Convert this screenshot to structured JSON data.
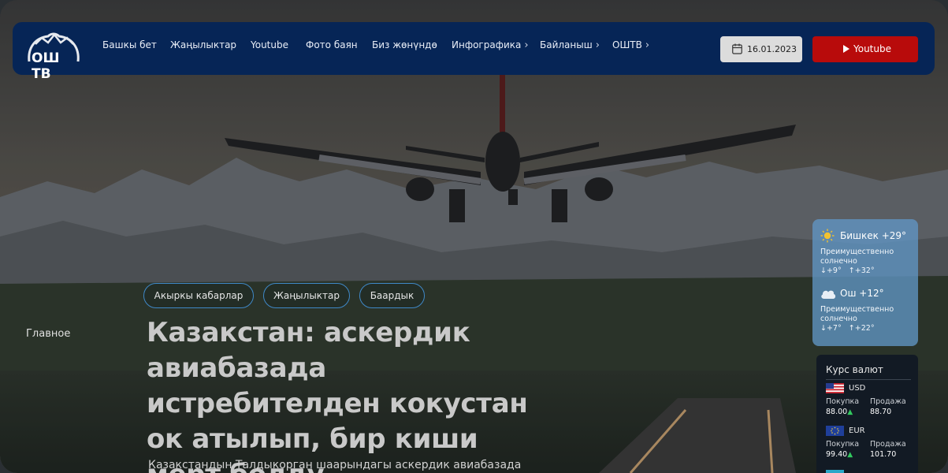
{
  "nav": {
    "logo_text": "ОШ ТВ",
    "items": [
      {
        "label": "Башкы бет",
        "dropdown": false
      },
      {
        "label": "Жаңылыктар",
        "dropdown": false
      },
      {
        "label": "Youtube",
        "dropdown": false
      },
      {
        "label": "Фото баян",
        "dropdown": false
      },
      {
        "label": "Биз жөнүндө",
        "dropdown": false
      },
      {
        "label": "Инфографика",
        "dropdown": true
      },
      {
        "label": "Байланыш",
        "dropdown": true
      },
      {
        "label": "ОШТВ",
        "dropdown": true
      }
    ],
    "date": "16.01.2023",
    "youtube_button": "Youtube"
  },
  "hero": {
    "tags": [
      "Акыркы кабарлар",
      "Жаңылыктар",
      "Баардык"
    ],
    "side_label": "Главное",
    "headline": "Казакстан: аскердик авиабазада истребителден кокустан ок атылып, бир киши мерт болду",
    "subheadline": "Казакстандын Талдыкорган шаарындагы аскердик авиабазада"
  },
  "weather": [
    {
      "city": "Бишкек",
      "temp": "+29°",
      "icon": "sun-icon",
      "desc": "Преимущественно солнечно",
      "low": "+9°",
      "high": "+32°"
    },
    {
      "city": "Ош",
      "temp": "+12°",
      "icon": "cloud-icon",
      "desc": "Преимущественно солнечно",
      "low": "+7°",
      "high": "+22°"
    }
  ],
  "currency": {
    "title": "Курс валют",
    "buy_label": "Покупка",
    "sell_label": "Продажа",
    "rates": [
      {
        "code": "USD",
        "buy": "88.00",
        "sell": "88.70"
      },
      {
        "code": "EUR",
        "buy": "99.40",
        "sell": "101.70"
      }
    ]
  },
  "colors": {
    "nav_bg": "#062556",
    "youtube_red": "#b80b0b",
    "tag_border": "#3f88c7"
  }
}
